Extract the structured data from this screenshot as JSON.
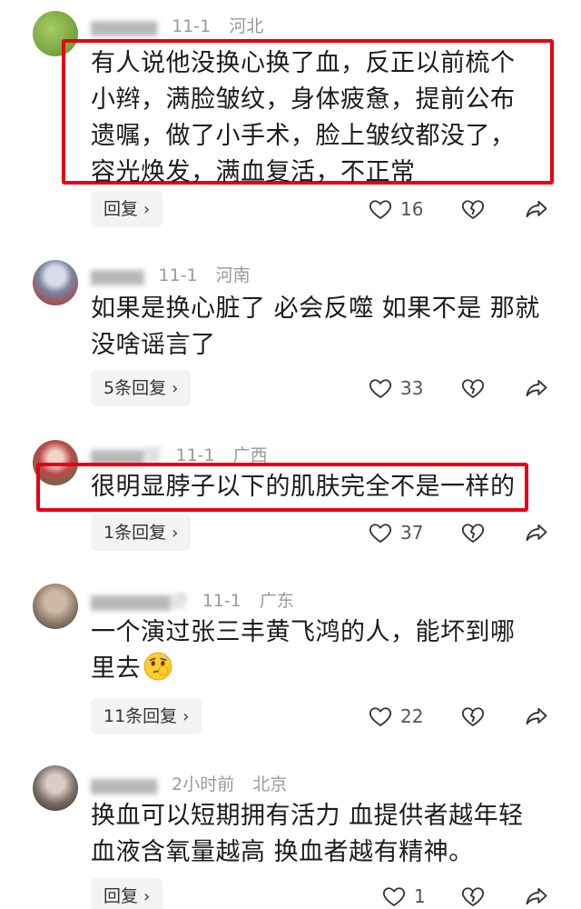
{
  "comments": [
    {
      "name": "▆▆▆▆▆",
      "date": "11-1",
      "location": "河北",
      "lines": [
        "有人说他没换心换了血，反正以前梳个",
        "小辫，满脸皱纹，身体疲惫，提前公布",
        "遗嘱，做了小手术，脸上皱纹都没了，",
        "容光焕发，满血复活，不正常"
      ],
      "reply_label": "回复",
      "likes": "16",
      "highlighted": true,
      "avatar_color": "#7fae4a"
    },
    {
      "name": "▆▆▆▆",
      "date": "11-1",
      "location": "河南",
      "lines": [
        "如果是换心脏了 必会反噬 如果不是 那就",
        "没啥谣言了"
      ],
      "reply_label": "5条回复",
      "likes": "33",
      "highlighted": false,
      "avatar_color": "#8a8fa6"
    },
    {
      "name": "▆▆▆▆邹",
      "date": "11-1",
      "location": "广西",
      "lines": [
        "很明显脖子以下的肌肤完全不是一样的"
      ],
      "reply_label": "1条回复",
      "likes": "37",
      "highlighted": true,
      "avatar_color": "#b84848"
    },
    {
      "name": "▆▆▆▆▆▆迹",
      "date": "11-1",
      "location": "广东",
      "lines": [
        "一个演过张三丰黄飞鸿的人，能坏到哪",
        "里去"
      ],
      "reply_label": "11条回复",
      "likes": "22",
      "highlighted": false,
      "avatar_color": "#9b8a7a"
    },
    {
      "name": "▆▆▆▆▆",
      "date": "2小时前",
      "location": "北京",
      "lines": [
        "换血可以短期拥有活力 血提供者越年轻",
        "血液含氧量越高 换血者越有精神。"
      ],
      "reply_label": "回复",
      "likes": "1",
      "highlighted": false,
      "avatar_color": "#6f6a66"
    }
  ],
  "colors": {
    "highlight": "#e60012",
    "meta": "#9a9a9a",
    "reply_bg": "#f3f3f3"
  },
  "icons": {
    "like": "heart-icon",
    "dislike": "broken-heart-icon",
    "share": "share-arrow-icon",
    "emoji": "thinking-face-emoji"
  }
}
